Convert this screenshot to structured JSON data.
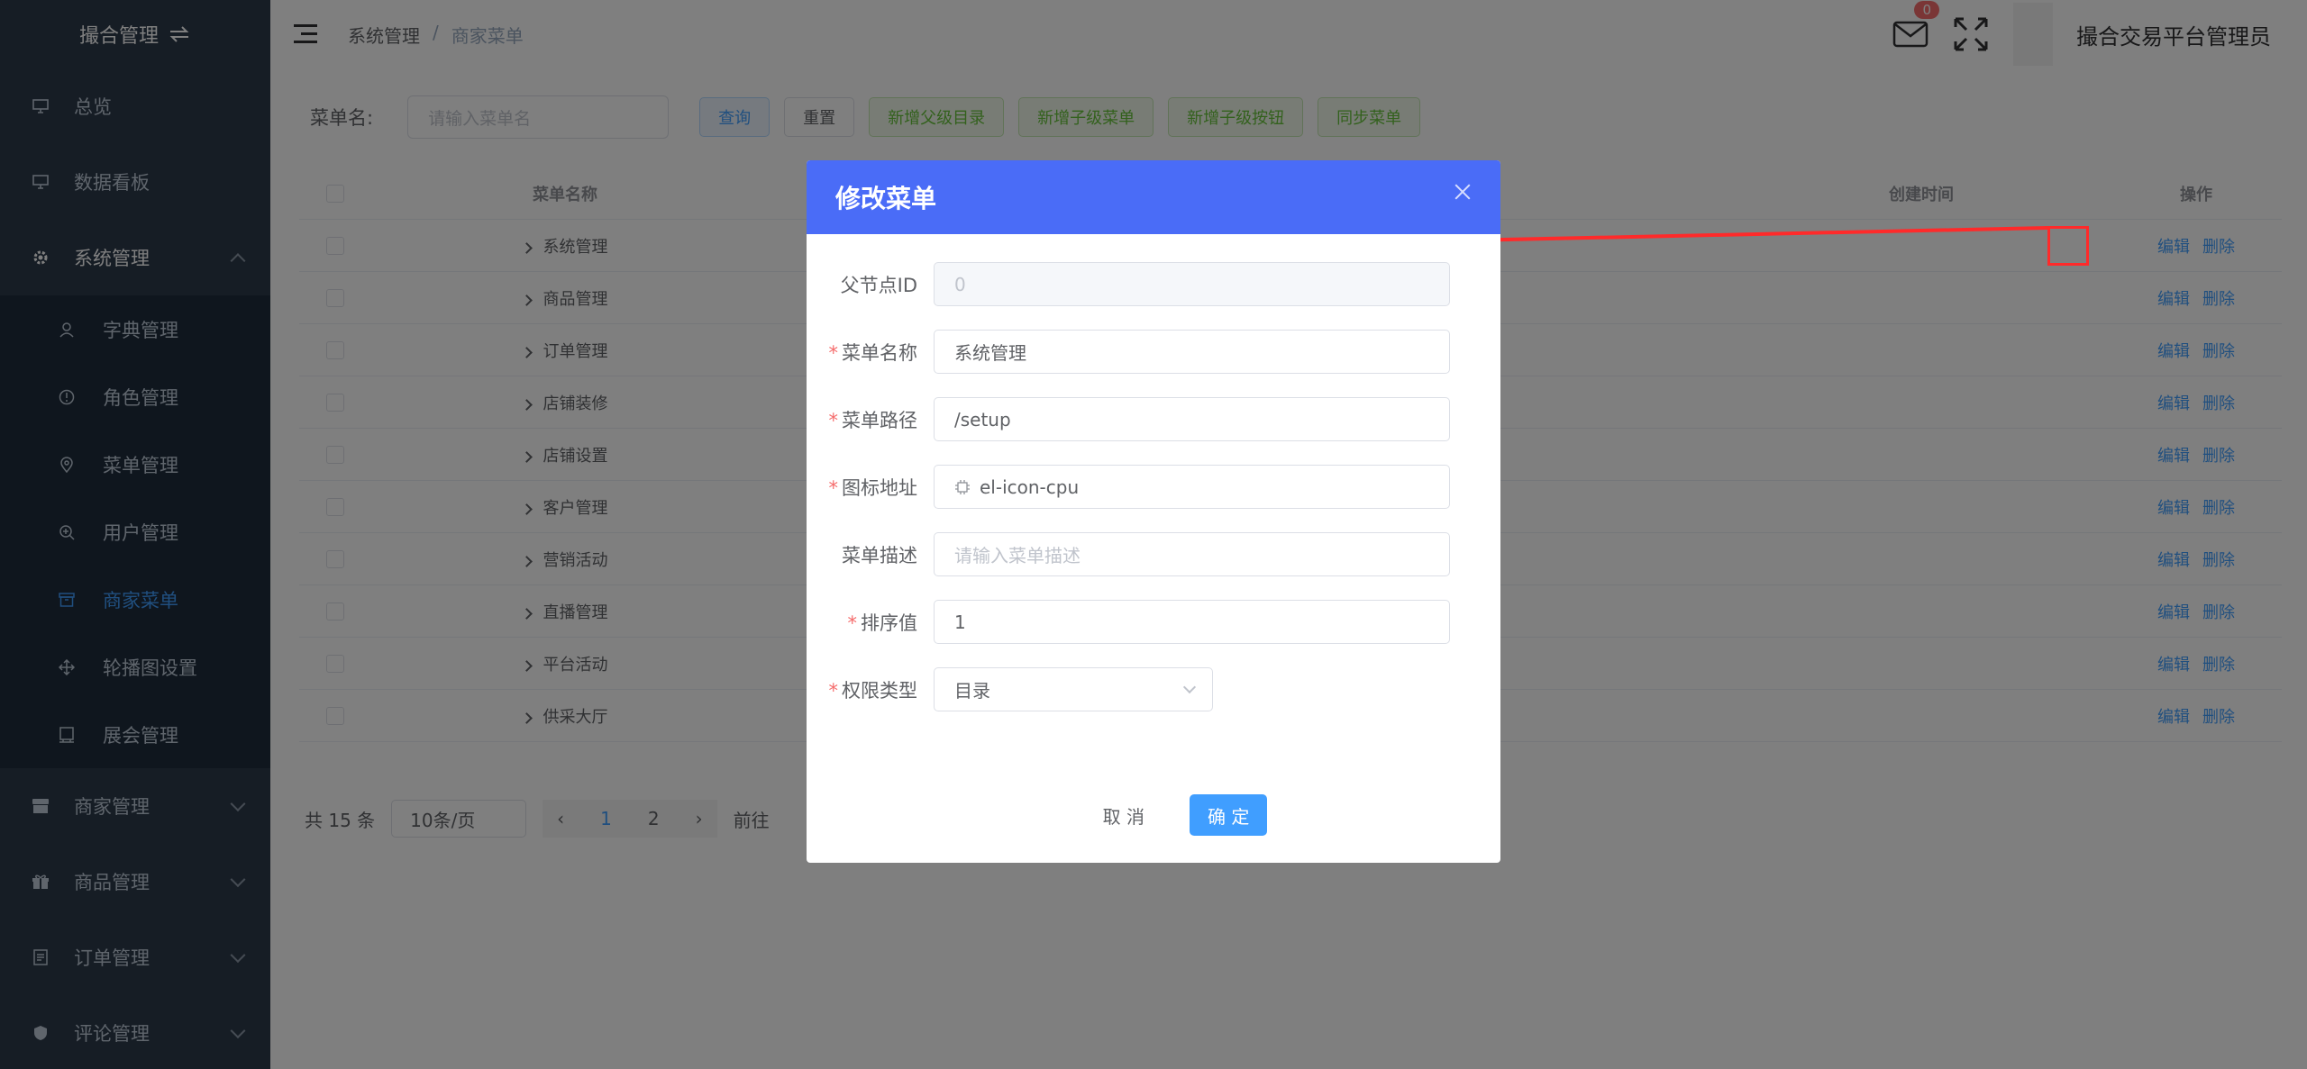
{
  "sidebar": {
    "logo_text": "撮合管理",
    "items": [
      {
        "label": "总览"
      },
      {
        "label": "数据看板"
      },
      {
        "label": "系统管理"
      }
    ],
    "submenu": [
      {
        "label": "字典管理"
      },
      {
        "label": "角色管理"
      },
      {
        "label": "菜单管理"
      },
      {
        "label": "用户管理"
      },
      {
        "label": "商家菜单"
      },
      {
        "label": "轮播图设置"
      },
      {
        "label": "展会管理"
      }
    ],
    "bottom_items": [
      {
        "label": "商家管理"
      },
      {
        "label": "商品管理"
      },
      {
        "label": "订单管理"
      },
      {
        "label": "评论管理"
      }
    ]
  },
  "header": {
    "breadcrumb": [
      "系统管理",
      "商家菜单"
    ],
    "breadcrumb_sep": "/",
    "badge_count": "0",
    "username": "撮合交易平台管理员"
  },
  "filter": {
    "label": "菜单名:",
    "placeholder": "请输入菜单名",
    "buttons": {
      "query": "查询",
      "reset": "重置",
      "add_parent": "新增父级目录",
      "add_child_menu": "新增子级菜单",
      "add_child_button": "新增子级按钮",
      "sync": "同步菜单"
    }
  },
  "table": {
    "headers": {
      "name": "菜单名称",
      "time": "创建时间",
      "op": "操作"
    },
    "rows": [
      "系统管理",
      "商品管理",
      "订单管理",
      "店铺装修",
      "店铺设置",
      "客户管理",
      "营销活动",
      "直播管理",
      "平台活动",
      "供采大厅"
    ],
    "edit_label": "编辑",
    "delete_label": "删除"
  },
  "pager": {
    "total": "共 15 条",
    "size": "10条/页",
    "pages": [
      "1",
      "2"
    ],
    "goto": "前往"
  },
  "dialog": {
    "title": "修改菜单",
    "fields": {
      "parent_id": {
        "label": "父节点ID",
        "value": "0"
      },
      "name": {
        "label": "菜单名称",
        "value": "系统管理"
      },
      "path": {
        "label": "菜单路径",
        "value": "/setup"
      },
      "icon": {
        "label": "图标地址",
        "value": "el-icon-cpu"
      },
      "desc": {
        "label": "菜单描述",
        "placeholder": "请输入菜单描述"
      },
      "sort": {
        "label": "排序值",
        "value": "1"
      },
      "perm": {
        "label": "权限类型",
        "value": "目录"
      }
    },
    "required_mark": "*",
    "cancel": "取 消",
    "confirm": "确 定"
  },
  "colors": {
    "sidebar_bg": "#2d3a4b",
    "accent": "#409eff",
    "dialog_header": "#4a6cf7",
    "annotation": "#ff2a2a"
  }
}
